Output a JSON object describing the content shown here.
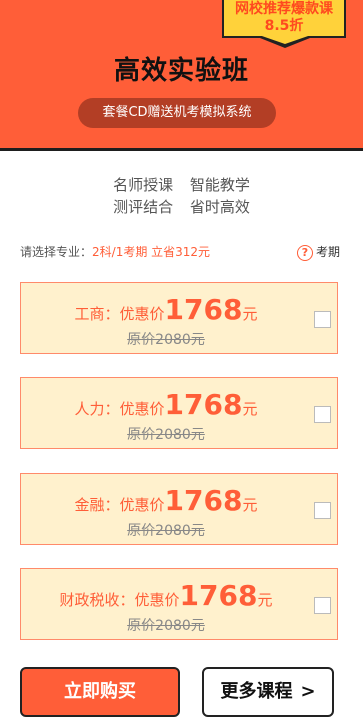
{
  "header": {
    "ribbon_line1": "网校推荐爆款课",
    "ribbon_line2": "8.5折",
    "title": "高效实验班",
    "subtitle": "套餐CD赠送机考模拟系统"
  },
  "features": {
    "row1": [
      "名师授课",
      "智能教学"
    ],
    "row2": [
      "测评结合",
      "省时高效"
    ]
  },
  "major": {
    "label": "请选择专业：",
    "value": "2科/1考期 立省312元",
    "help_icon_glyph": "?",
    "help_text": "考期"
  },
  "courses": [
    {
      "name": "工商：优惠价",
      "price": "1768",
      "unit": "元",
      "original": "原价2080元"
    },
    {
      "name": "人力：优惠价",
      "price": "1768",
      "unit": "元",
      "original": "原价2080元"
    },
    {
      "name": "金融：优惠价",
      "price": "1768",
      "unit": "元",
      "original": "原价2080元"
    },
    {
      "name": "财政税收：优惠价",
      "price": "1768",
      "unit": "元",
      "original": "原价2080元"
    }
  ],
  "buttons": {
    "buy": "立即购买",
    "more": "更多课程",
    "more_chevron": ">"
  },
  "colors": {
    "accent": "#ff5e38",
    "card_bg": "#fff1cd",
    "ribbon": "#ffd23a"
  }
}
